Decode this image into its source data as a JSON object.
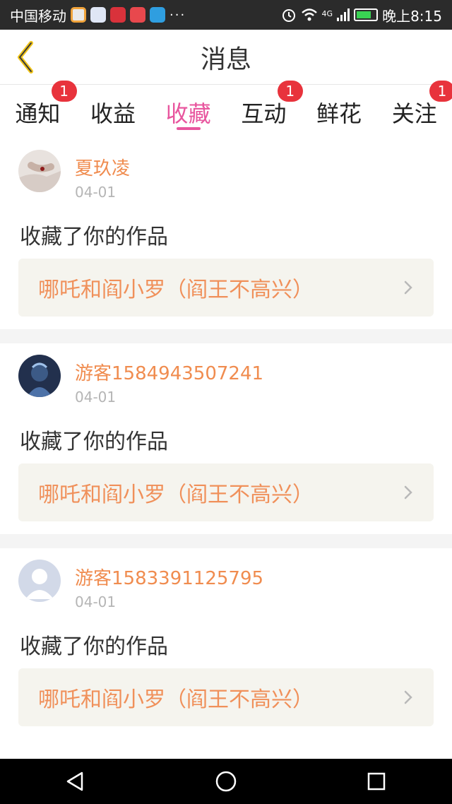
{
  "status_bar": {
    "carrier": "中国移动",
    "more": "···",
    "network": "4G",
    "time": "晚上8:15"
  },
  "header": {
    "title": "消息",
    "back_icon": "chevron-left-icon",
    "accent": "#e8559e"
  },
  "tabs": [
    {
      "label": "通知",
      "badge": "1"
    },
    {
      "label": "收益",
      "badge": ""
    },
    {
      "label": "收藏",
      "badge": "",
      "active": true
    },
    {
      "label": "互动",
      "badge": "1"
    },
    {
      "label": "鲜花",
      "badge": ""
    },
    {
      "label": "关注",
      "badge": "1"
    }
  ],
  "messages": [
    {
      "user": "夏玖凌",
      "time": "04-01",
      "action": "收藏了你的作品",
      "work": "哪吒和阎小罗（阎王不高兴）",
      "avatar": "photo-avatar"
    },
    {
      "user": "游客1584943507241",
      "time": "04-01",
      "action": "收藏了你的作品",
      "work": "哪吒和阎小罗（阎王不高兴）",
      "avatar": "anime-avatar"
    },
    {
      "user": "游客1583391125795",
      "time": "04-01",
      "action": "收藏了你的作品",
      "work": "哪吒和阎小罗（阎王不高兴）",
      "avatar": "default-avatar"
    }
  ],
  "nav": {
    "back": "back-triangle-icon",
    "home": "home-circle-icon",
    "recent": "recent-square-icon"
  }
}
